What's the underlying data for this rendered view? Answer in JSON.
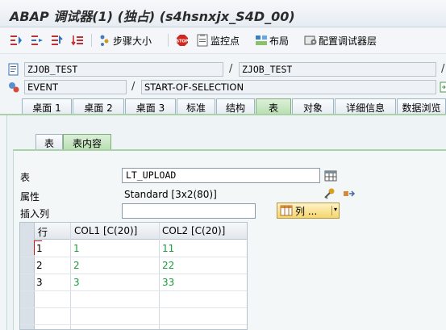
{
  "window": {
    "title": "ABAP 调试器(1)  (独占) (s4hsnxjx_S4D_00)"
  },
  "toolbar": {
    "step_size_label": "步骤大小",
    "watchpoint_label": "监控点",
    "layout_label": "布局",
    "configure_layers_label": "配置调试器层"
  },
  "fields": {
    "program1": "ZJOB_TEST",
    "program2": "ZJOB_TEST",
    "event_type": "EVENT",
    "event_name": "START-OF-SELECTION"
  },
  "tabs": [
    "桌面 1",
    "桌面 2",
    "桌面 3",
    "标准",
    "结构",
    "表",
    "对象",
    "详细信息",
    "数据浏览"
  ],
  "active_tab": "表",
  "subtabs": [
    "表",
    "表内容"
  ],
  "active_subtab": "表内容",
  "table_panel": {
    "table_label": "表",
    "table_value": "LT_UPLOAD",
    "attribute_label": "属性",
    "attribute_value": "Standard [3x2(80)]",
    "insert_column_label": "插入列",
    "insert_column_value": "",
    "columns_button_label": "列 ..."
  },
  "grid": {
    "headers": [
      "行",
      "COL1 [C(20)]",
      "COL2 [C(20)]"
    ],
    "rows": [
      {
        "row": "1",
        "col1": "1",
        "col2": "11"
      },
      {
        "row": "2",
        "col1": "2",
        "col2": "22"
      },
      {
        "row": "3",
        "col1": "3",
        "col2": "33"
      }
    ]
  }
}
